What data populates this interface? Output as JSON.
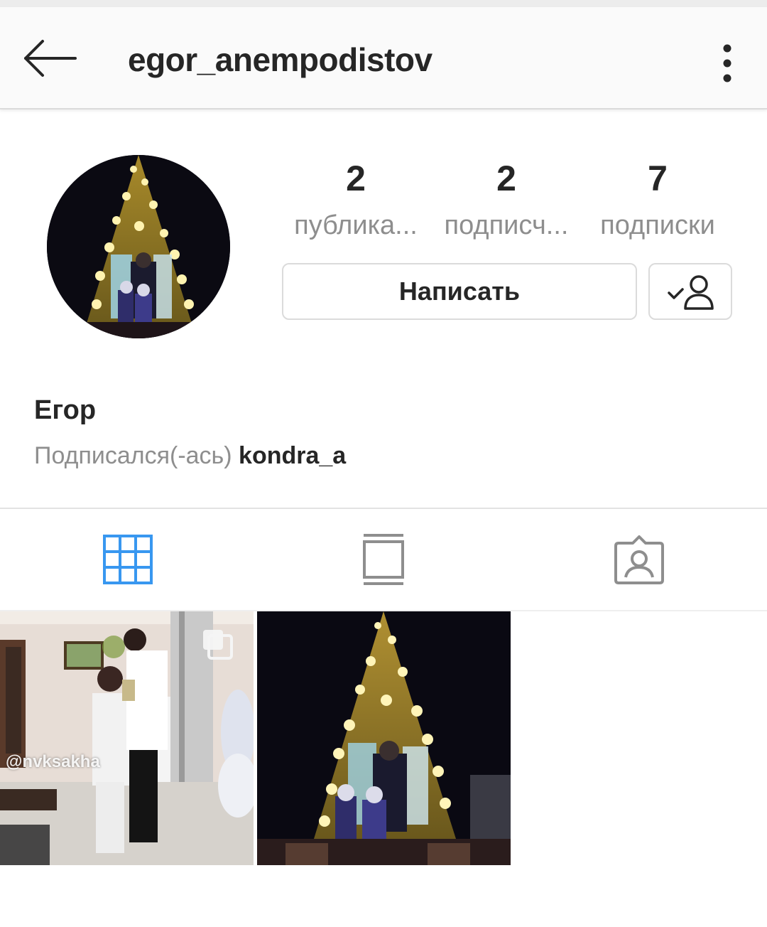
{
  "header": {
    "username": "egor_anempodistov",
    "back_icon": "arrow-left-icon",
    "menu_icon": "more-vertical-icon"
  },
  "profile": {
    "full_name": "Егор",
    "followed_by_prefix": "Подписался(-ась)",
    "followed_by_user": "kondra_a"
  },
  "stats": [
    {
      "value": "2",
      "label": "публика..."
    },
    {
      "value": "2",
      "label": "подписч..."
    },
    {
      "value": "7",
      "label": "подписки"
    }
  ],
  "actions": {
    "message_label": "Написать",
    "following_icon": "person-check-icon"
  },
  "tabs": [
    {
      "icon": "grid-icon",
      "active": true
    },
    {
      "icon": "feed-icon",
      "active": false
    },
    {
      "icon": "tagged-person-icon",
      "active": false
    }
  ],
  "posts": [
    {
      "watermark": "@nvksakha",
      "multi": true
    },
    {
      "watermark": "",
      "multi": false
    }
  ],
  "colors": {
    "accent": "#3897f0",
    "text": "#262626",
    "secondary": "#8e8e8e",
    "border": "#dbdbdb"
  }
}
